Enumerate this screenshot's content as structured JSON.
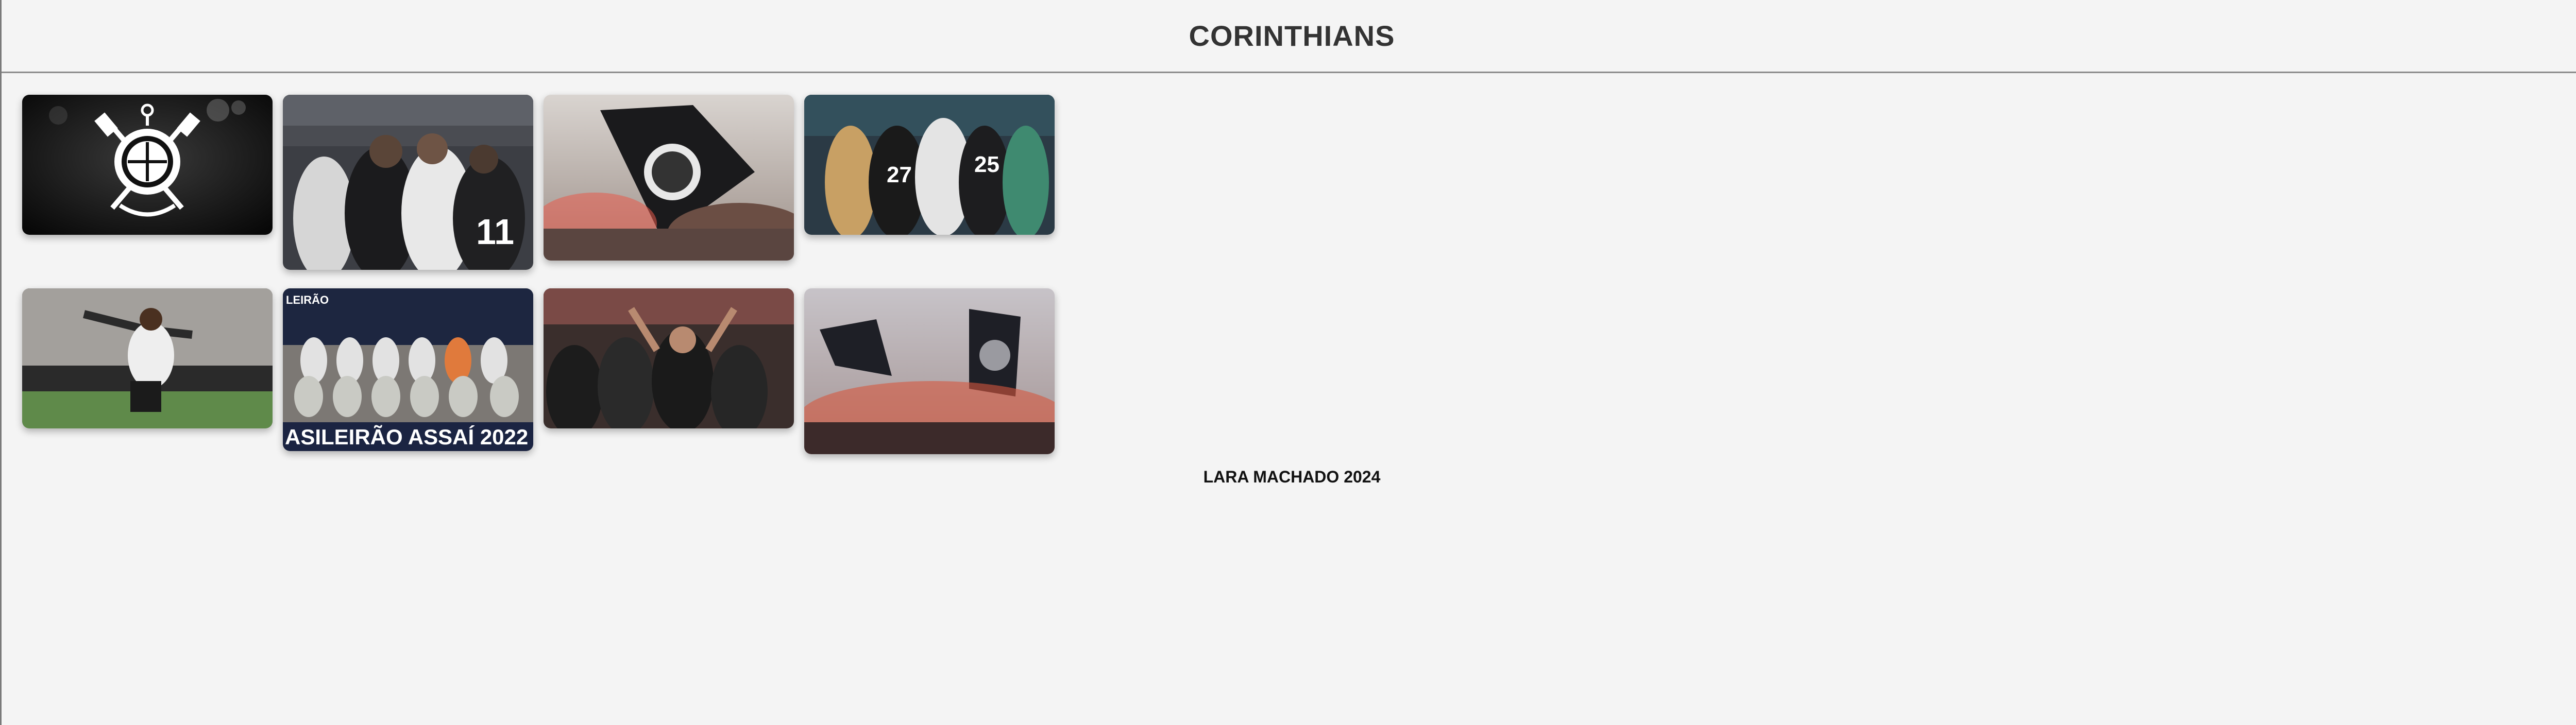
{
  "header": {
    "title": "CORINTHIANS"
  },
  "gallery": {
    "photos": [
      {
        "subject": "club crest on dark background",
        "icon": "crest-icon"
      },
      {
        "subject": "players embracing in white kits"
      },
      {
        "subject": "fans waving black flag with flares"
      },
      {
        "subject": "team huddle celebrating"
      },
      {
        "subject": "player celebrating on pitch"
      },
      {
        "subject": "team photo",
        "banner_text": "ASILEIRÃO ASSAÍ 2022",
        "top_text": "LEIRÃO"
      },
      {
        "subject": "supporters cheering in stands"
      },
      {
        "subject": "flags and red flares over crowd"
      }
    ]
  },
  "footer": {
    "credit": "LARA MACHADO 2024"
  }
}
